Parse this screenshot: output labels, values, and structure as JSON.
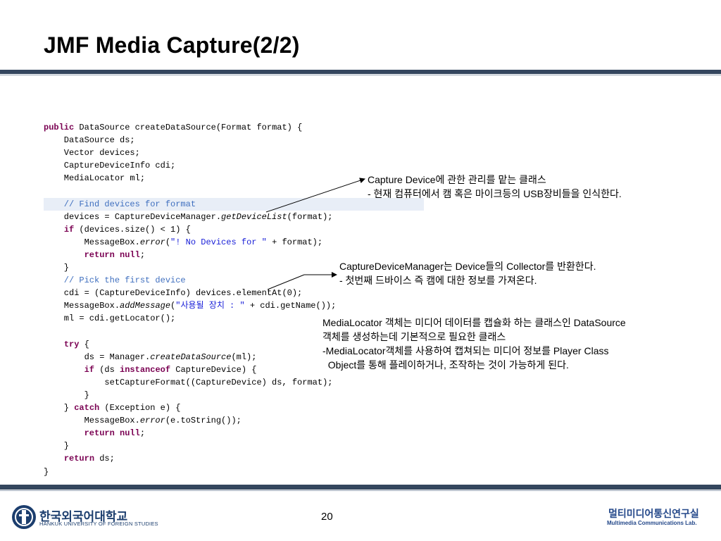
{
  "slide": {
    "title": "JMF Media Capture(2/2)",
    "page_number": "20"
  },
  "code_lines": [
    {
      "segments": [
        {
          "t": "public",
          "c": "kw"
        },
        {
          "t": " DataSource createDataSource(Format format) {",
          "c": ""
        }
      ],
      "highlight": false
    },
    {
      "segments": [
        {
          "t": "    DataSource ds;",
          "c": ""
        }
      ],
      "highlight": false
    },
    {
      "segments": [
        {
          "t": "    Vector devices;",
          "c": ""
        }
      ],
      "highlight": false
    },
    {
      "segments": [
        {
          "t": "    CaptureDeviceInfo cdi;",
          "c": ""
        }
      ],
      "highlight": false
    },
    {
      "segments": [
        {
          "t": "    MediaLocator ml;",
          "c": ""
        }
      ],
      "highlight": false
    },
    {
      "segments": [
        {
          "t": "",
          "c": ""
        }
      ],
      "highlight": false
    },
    {
      "segments": [
        {
          "t": "    // Find devices for format",
          "c": "cm"
        }
      ],
      "highlight": true
    },
    {
      "segments": [
        {
          "t": "    devices = CaptureDeviceManager.",
          "c": ""
        },
        {
          "t": "getDeviceList",
          "c": "it"
        },
        {
          "t": "(format);",
          "c": ""
        }
      ],
      "highlight": false
    },
    {
      "segments": [
        {
          "t": "    ",
          "c": ""
        },
        {
          "t": "if",
          "c": "kw"
        },
        {
          "t": " (devices.size() < 1) {",
          "c": ""
        }
      ],
      "highlight": false
    },
    {
      "segments": [
        {
          "t": "        MessageBox.",
          "c": ""
        },
        {
          "t": "error",
          "c": "it"
        },
        {
          "t": "(",
          "c": ""
        },
        {
          "t": "\"! No Devices for \"",
          "c": "st"
        },
        {
          "t": " + format);",
          "c": ""
        }
      ],
      "highlight": false
    },
    {
      "segments": [
        {
          "t": "        ",
          "c": ""
        },
        {
          "t": "return null",
          "c": "kw"
        },
        {
          "t": ";",
          "c": ""
        }
      ],
      "highlight": false
    },
    {
      "segments": [
        {
          "t": "    }",
          "c": ""
        }
      ],
      "highlight": false
    },
    {
      "segments": [
        {
          "t": "    // Pick the first device",
          "c": "cm"
        }
      ],
      "highlight": false
    },
    {
      "segments": [
        {
          "t": "    cdi = (CaptureDeviceInfo) devices.elementAt(0);",
          "c": ""
        }
      ],
      "highlight": false
    },
    {
      "segments": [
        {
          "t": "    MessageBox.",
          "c": ""
        },
        {
          "t": "addMessage",
          "c": "it"
        },
        {
          "t": "(",
          "c": ""
        },
        {
          "t": "\"사용될 장치 : \"",
          "c": "st"
        },
        {
          "t": " + cdi.getName());",
          "c": ""
        }
      ],
      "highlight": false
    },
    {
      "segments": [
        {
          "t": "    ml = cdi.getLocator();",
          "c": ""
        }
      ],
      "highlight": false
    },
    {
      "segments": [
        {
          "t": "",
          "c": ""
        }
      ],
      "highlight": false
    },
    {
      "segments": [
        {
          "t": "    ",
          "c": ""
        },
        {
          "t": "try",
          "c": "kw"
        },
        {
          "t": " {",
          "c": ""
        }
      ],
      "highlight": false
    },
    {
      "segments": [
        {
          "t": "        ds = Manager.",
          "c": ""
        },
        {
          "t": "createDataSource",
          "c": "it"
        },
        {
          "t": "(ml);",
          "c": ""
        }
      ],
      "highlight": false
    },
    {
      "segments": [
        {
          "t": "        ",
          "c": ""
        },
        {
          "t": "if",
          "c": "kw"
        },
        {
          "t": " (ds ",
          "c": ""
        },
        {
          "t": "instanceof",
          "c": "kw"
        },
        {
          "t": " CaptureDevice) {",
          "c": ""
        }
      ],
      "highlight": false
    },
    {
      "segments": [
        {
          "t": "            setCaptureFormat((CaptureDevice) ds, format);",
          "c": ""
        }
      ],
      "highlight": false
    },
    {
      "segments": [
        {
          "t": "        }",
          "c": ""
        }
      ],
      "highlight": false
    },
    {
      "segments": [
        {
          "t": "    } ",
          "c": ""
        },
        {
          "t": "catch",
          "c": "kw"
        },
        {
          "t": " (Exception e) {",
          "c": ""
        }
      ],
      "highlight": false
    },
    {
      "segments": [
        {
          "t": "        MessageBox.",
          "c": ""
        },
        {
          "t": "error",
          "c": "it"
        },
        {
          "t": "(e.toString());",
          "c": ""
        }
      ],
      "highlight": false
    },
    {
      "segments": [
        {
          "t": "        ",
          "c": ""
        },
        {
          "t": "return null",
          "c": "kw"
        },
        {
          "t": ";",
          "c": ""
        }
      ],
      "highlight": false
    },
    {
      "segments": [
        {
          "t": "    }",
          "c": ""
        }
      ],
      "highlight": false
    },
    {
      "segments": [
        {
          "t": "    ",
          "c": ""
        },
        {
          "t": "return",
          "c": "kw"
        },
        {
          "t": " ds;",
          "c": ""
        }
      ],
      "highlight": false
    },
    {
      "segments": [
        {
          "t": "}",
          "c": ""
        }
      ],
      "highlight": false
    }
  ],
  "notes": {
    "note1": "Capture Device에 관한 관리를 맡는 클래스\n- 현재 컴퓨터에서 캠 혹은 마이크등의 USB장비들을 인식한다.",
    "note2": "CaptureDeviceManager는 Device들의 Collector를 반환한다.\n- 첫번째 드바이스 즉 캠에 대한 정보를 가져온다.",
    "note3": "MediaLocator 객체는 미디어 데이터를 캡슐화 하는 클래스인 DataSource\n객체를 생성하는데 기본적으로 필요한 클래스\n-MediaLocator객체를 사용하여 캡쳐되는 미디어 정보를 Player Class\n  Object를 통해 플레이하거나, 조작하는 것이 가능하게 된다."
  },
  "footer": {
    "university_ko": "한국외국어대학교",
    "university_en": "HANKUK UNIVERSITY OF FOREIGN STUDIES",
    "lab_ko": "멀티미디어통신연구실",
    "lab_en": "Multimedia Communications Lab."
  },
  "colors": {
    "bar": "#34465e",
    "keyword": "#7a0052",
    "comment": "#3f6fbf",
    "string": "#1a20d8",
    "logo": "#1c3e6e"
  }
}
